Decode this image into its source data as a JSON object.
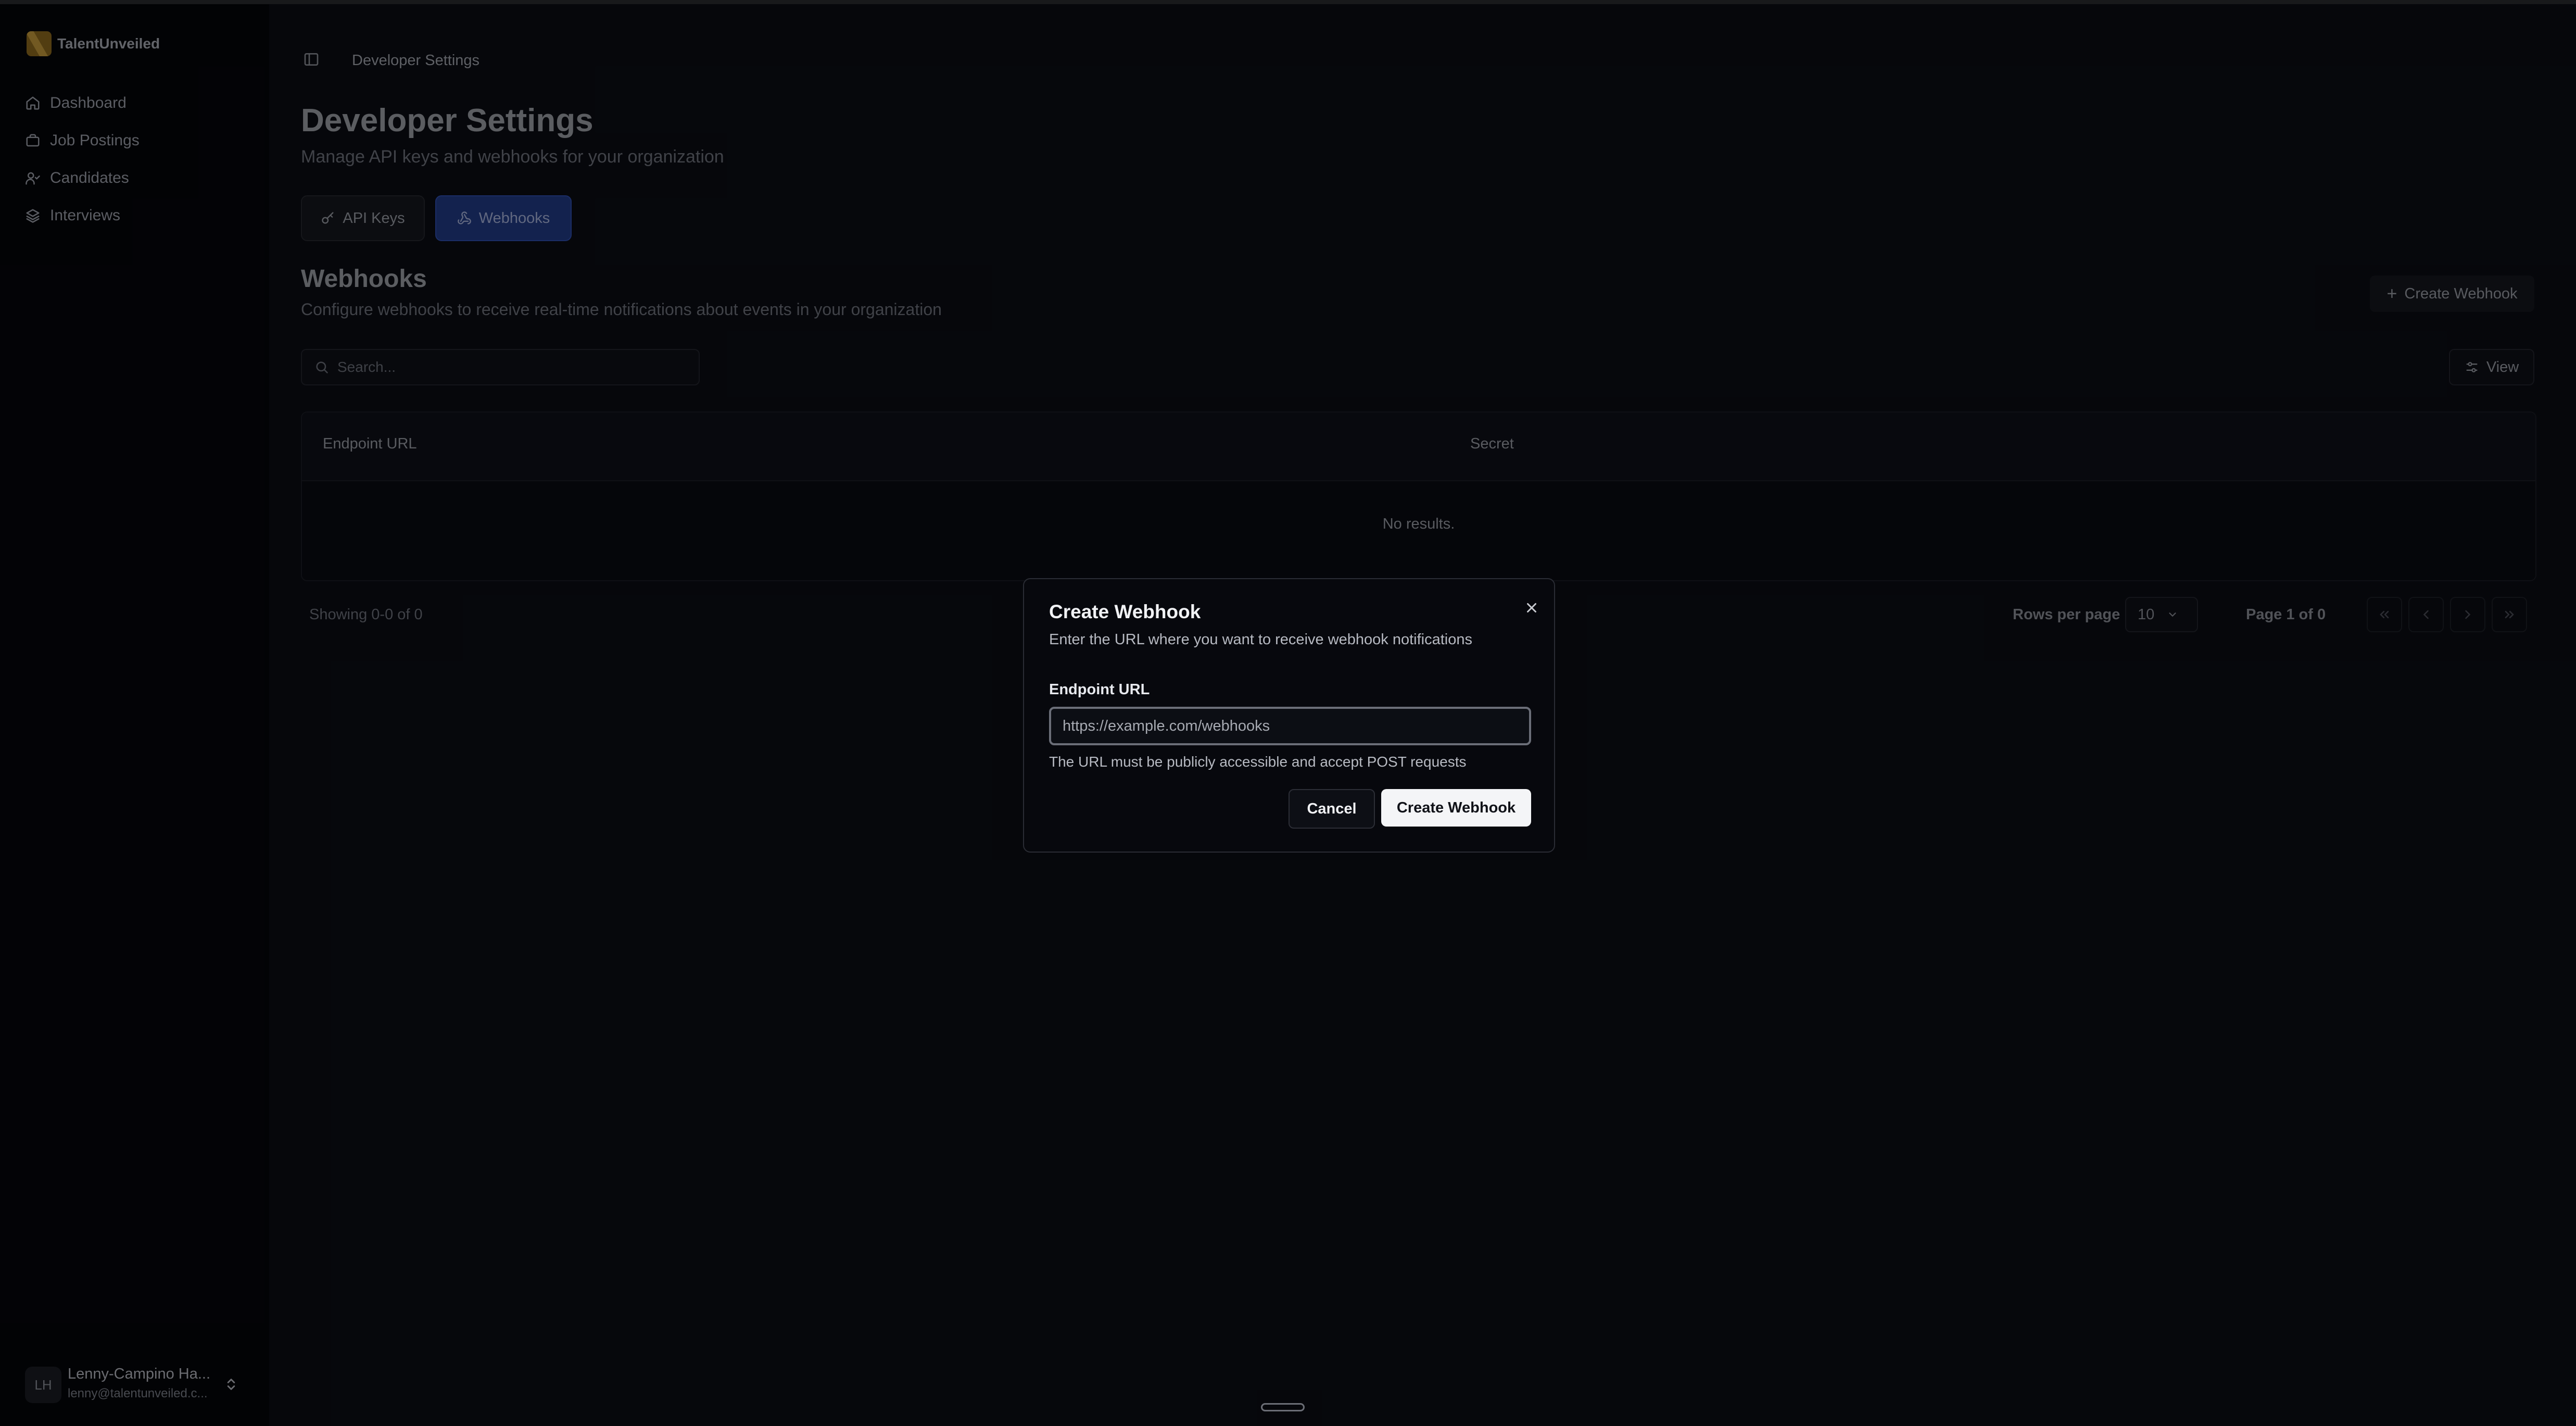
{
  "brand": {
    "name": "TalentUnveiled"
  },
  "sidebar": {
    "items": [
      {
        "label": "Dashboard",
        "icon": "home-icon"
      },
      {
        "label": "Job Postings",
        "icon": "briefcase-icon"
      },
      {
        "label": "Candidates",
        "icon": "user-check-icon"
      },
      {
        "label": "Interviews",
        "icon": "layers-icon"
      }
    ]
  },
  "user": {
    "initials": "LH",
    "name": "Lenny-Campino Ha...",
    "email": "lenny@talentunveiled.c..."
  },
  "header": {
    "breadcrumb": "Developer Settings"
  },
  "page": {
    "title": "Developer Settings",
    "subtitle": "Manage API keys and webhooks for your organization",
    "tabs": [
      {
        "label": "API Keys",
        "active": false
      },
      {
        "label": "Webhooks",
        "active": true
      }
    ]
  },
  "section": {
    "title": "Webhooks",
    "description": "Configure webhooks to receive real-time notifications about events in your organization",
    "create_button": "Create Webhook",
    "view_button": "View",
    "search_placeholder": "Search..."
  },
  "table": {
    "columns": [
      "Endpoint URL",
      "Secret"
    ],
    "empty_text": "No results."
  },
  "pagination": {
    "showing": "Showing 0-0 of 0",
    "rows_per_page_label": "Rows per page",
    "rows_per_page_value": "10",
    "page_info": "Page 1 of 0"
  },
  "modal": {
    "title": "Create Webhook",
    "description": "Enter the URL where you want to receive webhook notifications",
    "field_label": "Endpoint URL",
    "field_placeholder": "https://example.com/webhooks",
    "help_text": "The URL must be publicly accessible and accept POST requests",
    "cancel_label": "Cancel",
    "submit_label": "Create Webhook"
  },
  "colors": {
    "accent": "#2b4fb0",
    "background": "#0b0d14",
    "sidebar": "#05060a"
  }
}
